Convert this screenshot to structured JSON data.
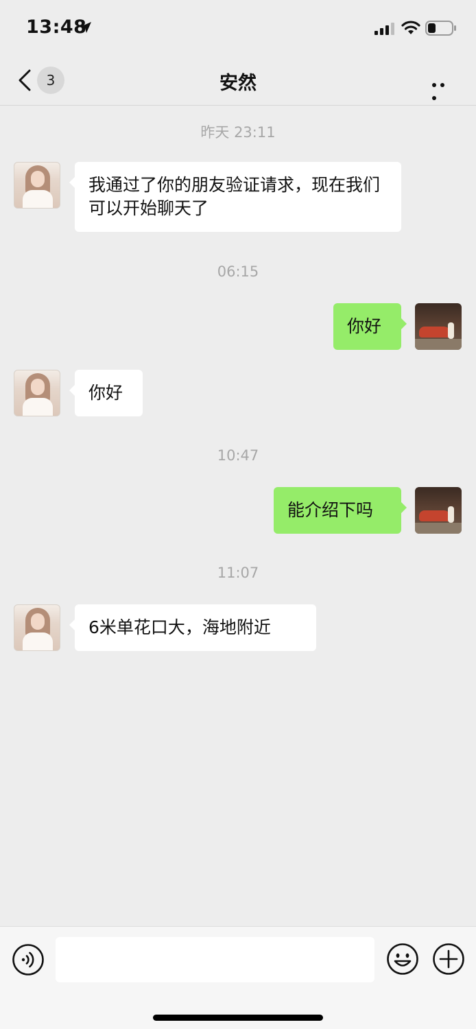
{
  "status_bar": {
    "time": "13:48",
    "icons": [
      "location-arrow-icon",
      "cellular-signal-icon",
      "wifi-icon",
      "battery-icon"
    ]
  },
  "nav": {
    "unread_count": "3",
    "title": "安然",
    "icons": [
      "back-chevron-icon",
      "more-dots-icon"
    ]
  },
  "messages": [
    {
      "type": "timestamp",
      "text": "昨天 23:11"
    },
    {
      "type": "message",
      "side": "left",
      "text": "我通过了你的朋友验证请求，现在我们可以开始聊天了"
    },
    {
      "type": "timestamp",
      "text": "06:15"
    },
    {
      "type": "message",
      "side": "right",
      "text": "你好"
    },
    {
      "type": "message",
      "side": "left",
      "text": "你好"
    },
    {
      "type": "timestamp",
      "text": "10:47"
    },
    {
      "type": "message",
      "side": "right",
      "text": "能介绍下吗"
    },
    {
      "type": "timestamp",
      "text": "11:07"
    },
    {
      "type": "message",
      "side": "left",
      "text": "6米单花口大，海地附近"
    }
  ],
  "input_bar": {
    "input_value": "",
    "icons": [
      "voice-icon",
      "emoji-icon",
      "plus-icon"
    ]
  },
  "colors": {
    "background": "#ededed",
    "sent_bubble": "#95ec69",
    "received_bubble": "#ffffff",
    "timestamp_text": "#a7a7a7"
  }
}
